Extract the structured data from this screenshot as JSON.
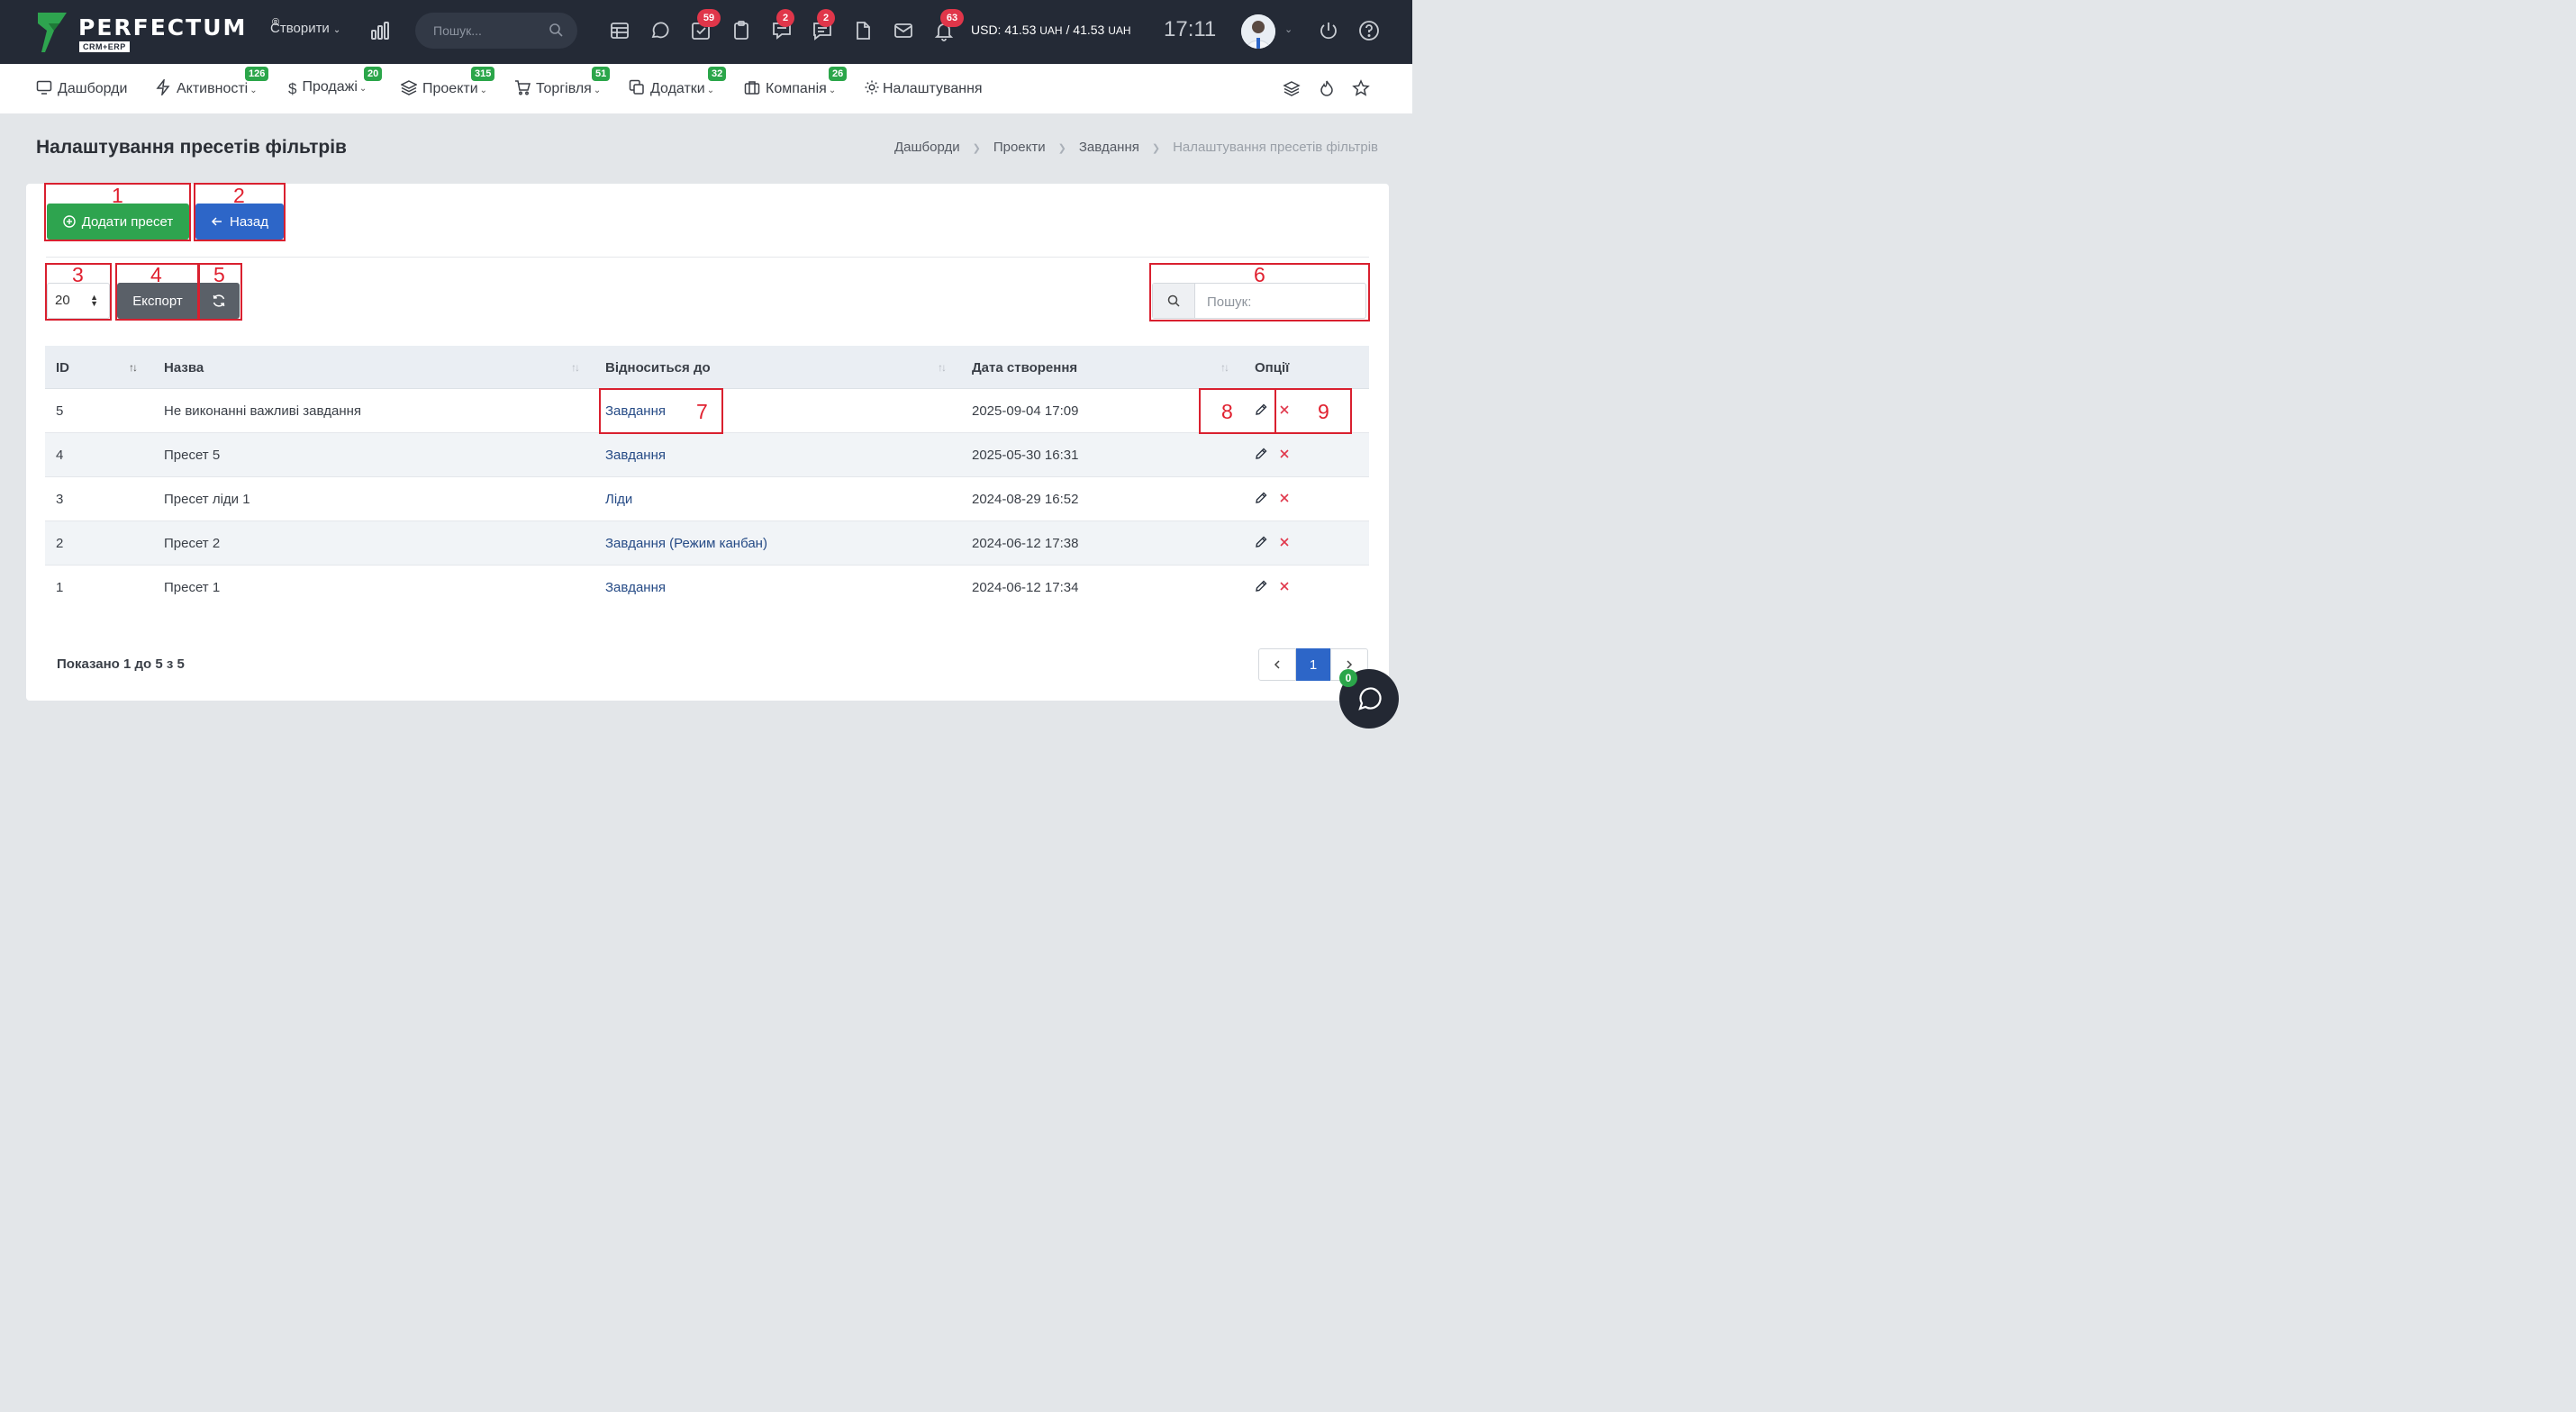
{
  "topbar": {
    "logo_text": "PERFECTUM",
    "logo_sub": "CRM+ERP",
    "logo_reg": "®",
    "create_label": "Створити",
    "search_placeholder": "Пошук...",
    "badges": {
      "tasks": "59",
      "chat": "2",
      "notes": "2",
      "notifications": "63"
    },
    "currency_usd": "USD: 41.53",
    "currency_uah_unit": "UAH",
    "currency_sep": " / 41.53",
    "time": "17:11"
  },
  "nav": {
    "items": [
      {
        "label": "Дашборди",
        "badge": ""
      },
      {
        "label": "Активності",
        "badge": "126"
      },
      {
        "label": "Продажі",
        "badge": "20"
      },
      {
        "label": "Проекти",
        "badge": "315"
      },
      {
        "label": "Торгівля",
        "badge": "51"
      },
      {
        "label": "Додатки",
        "badge": "32"
      },
      {
        "label": "Компанія",
        "badge": "26"
      },
      {
        "label": "Налаштування",
        "badge": ""
      }
    ]
  },
  "page": {
    "title": "Налаштування пресетів фільтрів",
    "breadcrumb": [
      "Дашборди",
      "Проекти",
      "Завдання",
      "Налаштування пресетів фільтрів"
    ]
  },
  "toolbar": {
    "add_label": "Додати пресет",
    "back_label": "Назад",
    "page_length": "20",
    "export_label": "Експорт",
    "search_placeholder": "Пошук:"
  },
  "table": {
    "columns": [
      "ID",
      "Назва",
      "Відноситься до",
      "Дата створення",
      "Опції"
    ],
    "rows": [
      {
        "id": "5",
        "name": "Не виконанні важливі завдання",
        "relates": "Завдання",
        "date": "2025-09-04 17:09"
      },
      {
        "id": "4",
        "name": "Пресет 5",
        "relates": "Завдання",
        "date": "2025-05-30 16:31"
      },
      {
        "id": "3",
        "name": "Пресет ліди 1",
        "relates": "Ліди",
        "date": "2024-08-29 16:52"
      },
      {
        "id": "2",
        "name": "Пресет 2",
        "relates": "Завдання (Режим канбан)",
        "date": "2024-06-12 17:38"
      },
      {
        "id": "1",
        "name": "Пресет 1",
        "relates": "Завдання",
        "date": "2024-06-12 17:34"
      }
    ]
  },
  "footer": {
    "info": "Показано 1 до 5 з 5",
    "current_page": "1",
    "chat_badge": "0"
  },
  "annotations": [
    "1",
    "2",
    "3",
    "4",
    "5",
    "6",
    "7",
    "8",
    "9"
  ],
  "colors": {
    "topbar_bg": "#242a36",
    "primary": "#2d66c8",
    "success": "#2ea44f",
    "danger": "#e0364a",
    "annotation": "#d9202f"
  }
}
